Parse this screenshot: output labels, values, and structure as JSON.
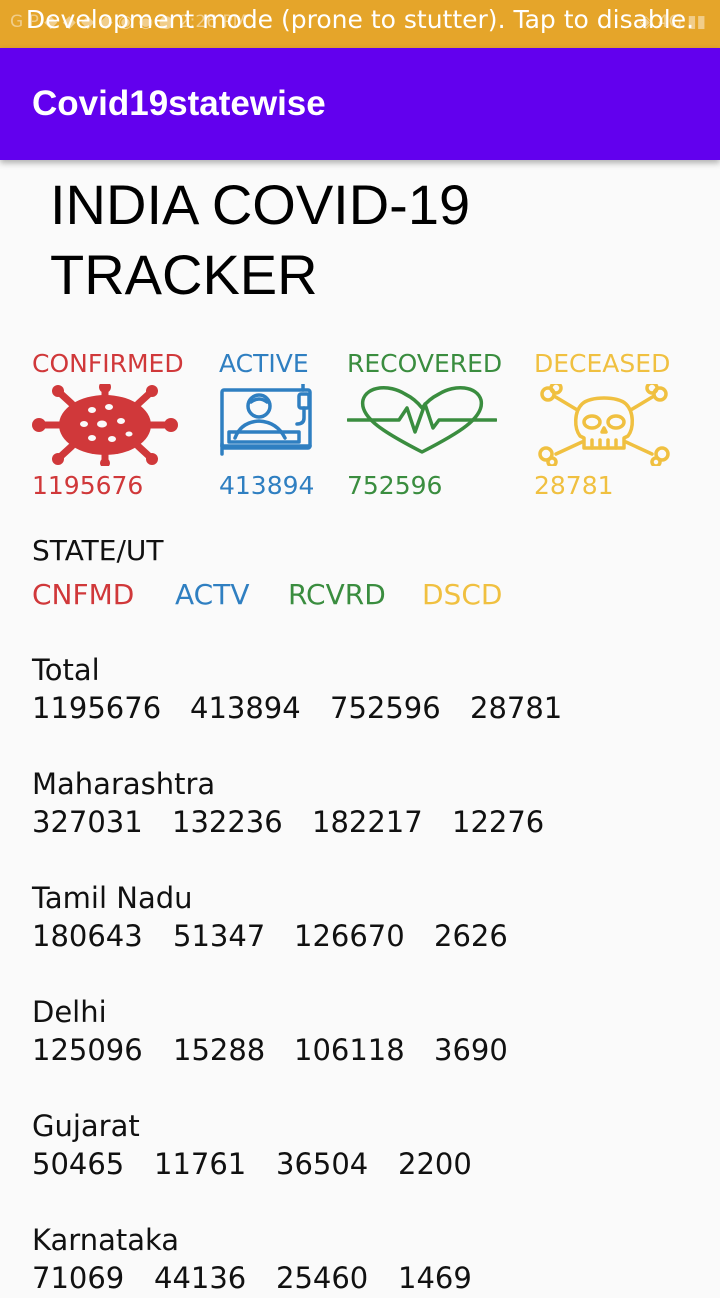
{
  "status_bar": {
    "left_ghost": "G  P  ◆  ◆  ◆  ◆  ◉  ◉  ●  2:26 PM",
    "right_ghost": "◈  4G  ▮▮",
    "banner": "Development mode (prone to stutter). Tap to disable."
  },
  "app_bar": {
    "title": "Covid19statewise"
  },
  "page": {
    "title": "INDIA COVID-19 TRACKER"
  },
  "stats": {
    "confirmed": {
      "label": "CONFIRMED",
      "value": "1195676",
      "icon": "virus-icon",
      "color": "#d0383a"
    },
    "active": {
      "label": "ACTIVE",
      "value": "413894",
      "icon": "patient-bed-icon",
      "color": "#2f7fc1"
    },
    "recovered": {
      "label": "RECOVERED",
      "value": "752596",
      "icon": "heartbeat-icon",
      "color": "#3a8d3f"
    },
    "deceased": {
      "label": "DECEASED",
      "value": "28781",
      "icon": "skull-icon",
      "color": "#f0c040"
    }
  },
  "table": {
    "heading": "STATE/UT",
    "columns": [
      "CNFMD",
      "ACTV",
      "RCVRD",
      "DSCD"
    ],
    "rows": [
      {
        "name": "Total",
        "values": [
          "1195676",
          "413894",
          "752596",
          "28781"
        ]
      },
      {
        "name": "Maharashtra",
        "values": [
          "327031",
          "132236",
          "182217",
          "12276"
        ]
      },
      {
        "name": "Tamil Nadu",
        "values": [
          "180643",
          "51347",
          "126670",
          "2626"
        ]
      },
      {
        "name": "Delhi",
        "values": [
          "125096",
          "15288",
          "106118",
          "3690"
        ]
      },
      {
        "name": "Gujarat",
        "values": [
          "50465",
          "11761",
          "36504",
          "2200"
        ]
      },
      {
        "name": "Karnataka",
        "values": [
          "71069",
          "44136",
          "25460",
          "1469"
        ]
      }
    ]
  }
}
